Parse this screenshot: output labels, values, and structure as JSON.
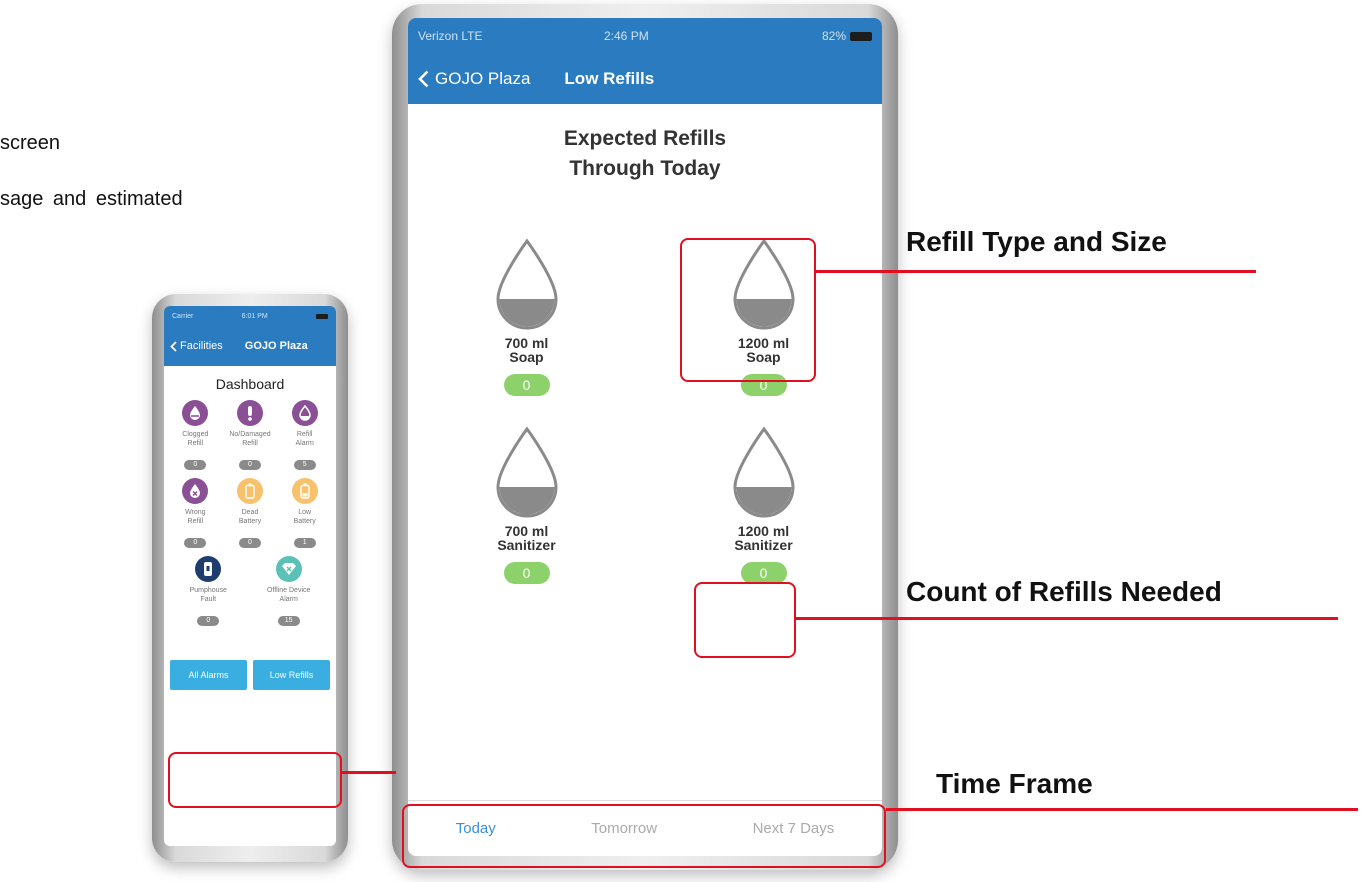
{
  "slide": {
    "text_fragment_1": "screen",
    "text_fragment_2": "sage and estimated"
  },
  "dashboard_phone": {
    "status": {
      "carrier": "Carrier",
      "time": "6:01 PM"
    },
    "nav": {
      "back_label": "Facilities",
      "title": "GOJO Plaza"
    },
    "heading": "Dashboard",
    "tiles": [
      {
        "label_line1": "Clogged",
        "label_line2": "Refill",
        "label_line3": "",
        "count": "0",
        "icon": "clogged-refill-icon",
        "color": "#8a4f95"
      },
      {
        "label_line1": "No/Damaged",
        "label_line2": "Refill",
        "label_line3": "",
        "count": "0",
        "icon": "exclamation-icon",
        "color": "#8a4f95"
      },
      {
        "label_line1": "Refill",
        "label_line2": "Alarm",
        "label_line3": "",
        "count": "5",
        "icon": "refill-alarm-icon",
        "color": "#8a4f95"
      },
      {
        "label_line1": "Wrong",
        "label_line2": "Refill",
        "label_line3": "",
        "count": "0",
        "icon": "wrong-refill-icon",
        "color": "#8a4f95"
      },
      {
        "label_line1": "Dead",
        "label_line2": "Battery",
        "label_line3": "",
        "count": "0",
        "icon": "dead-battery-icon",
        "color": "#f7c26b"
      },
      {
        "label_line1": "Low",
        "label_line2": "Battery",
        "label_line3": "",
        "count": "1",
        "icon": "low-battery-icon",
        "color": "#f7c26b"
      },
      {
        "label_line1": "Pumphouse",
        "label_line2": "Fault",
        "label_line3": "",
        "count": "0",
        "icon": "pumphouse-icon",
        "color": "#1f3c6e"
      },
      {
        "label_line1": "Offline Device",
        "label_line2": "Alarm",
        "label_line3": "",
        "count": "15",
        "icon": "offline-device-icon",
        "color": "#5bc0b5"
      }
    ],
    "buttons": {
      "all_alarms": "All Alarms",
      "low_refills": "Low Refills"
    }
  },
  "refills_phone": {
    "status": {
      "carrier": "Verizon  LTE",
      "time": "2:46 PM",
      "battery": "82%"
    },
    "nav": {
      "back_label": "GOJO Plaza",
      "title": "Low Refills"
    },
    "heading_line1": "Expected Refills",
    "heading_line2": "Through Today",
    "refills": [
      {
        "size": "700 ml",
        "type": "Soap",
        "count": "0",
        "fill_level": 0.45
      },
      {
        "size": "1200 ml",
        "type": "Soap",
        "count": "0",
        "fill_level": 0.45
      },
      {
        "size": "700 ml",
        "type": "Sanitizer",
        "count": "0",
        "fill_level": 0.45
      },
      {
        "size": "1200 ml",
        "type": "Sanitizer",
        "count": "0",
        "fill_level": 0.45
      }
    ],
    "tabs": [
      "Today",
      "Tomorrow",
      "Next 7 Days"
    ],
    "active_tab": "Today",
    "colors": {
      "nav_blue": "#2a7bbf",
      "count_green": "#8dd16a",
      "active_tab": "#3a8fd6"
    }
  },
  "annotations": {
    "refill_type_and_size": "Refill Type and Size",
    "count_of_refills": "Count of Refills Needed",
    "time_frame": "Time Frame",
    "color": "#e01020"
  }
}
